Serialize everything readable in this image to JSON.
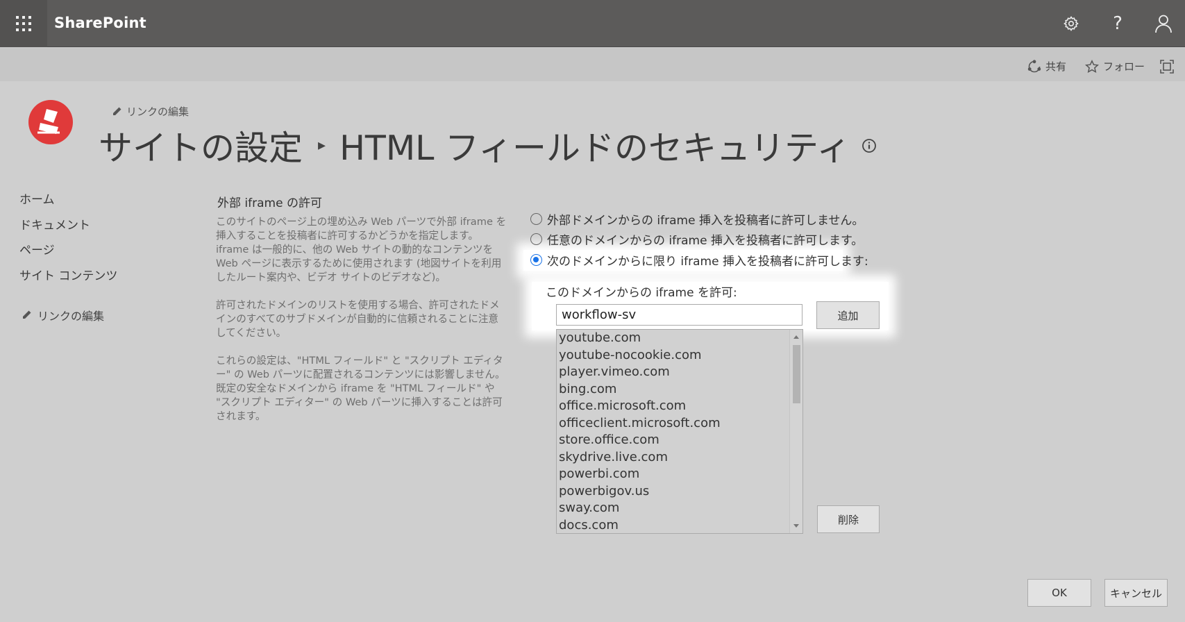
{
  "suitebar": {
    "brand": "SharePoint",
    "icons": [
      "app-launcher-icon",
      "settings-icon",
      "help-icon",
      "user-icon"
    ],
    "help_glyph": "?"
  },
  "commandbar": {
    "share": "共有",
    "follow": "フォロー"
  },
  "header": {
    "edit_links": "リンクの編集",
    "breadcrumb_parent": "サイトの設定",
    "breadcrumb_separator": "▸",
    "page_title": "HTML フィールドのセキュリティ"
  },
  "leftnav": {
    "items": [
      "ホーム",
      "ドキュメント",
      "ページ",
      "サイト コンテンツ"
    ],
    "edit_links": "リンクの編集"
  },
  "section": {
    "title": "外部 iframe の許可",
    "paragraphs": [
      "このサイトのページ上の埋め込み Web パーツで外部 iframe を挿入することを投稿者に許可するかどうかを指定します。iframe は一般的に、他の Web サイトの動的なコンテンツを Web ページに表示するために使用されます (地図サイトを利用したルート案内や、ビデオ サイトのビデオなど)。",
      "許可されたドメインのリストを使用する場合、許可されたドメインのすべてのサブドメインが自動的に信頼されることに注意してください。",
      "これらの設定は、\"HTML フィールド\" と \"スクリプト エディター\" の Web パーツに配置されるコンテンツには影響しません。既定の安全なドメインから iframe を \"HTML フィールド\" や \"スクリプト エディター\" の Web パーツに挿入することは許可されます。"
    ]
  },
  "options": [
    {
      "label": "外部ドメインからの iframe 挿入を投稿者に許可しません。",
      "checked": false
    },
    {
      "label": "任意のドメインからの iframe 挿入を投稿者に許可します。",
      "checked": false
    },
    {
      "label": "次のドメインからに限り iframe 挿入を投稿者に許可します:",
      "checked": true
    }
  ],
  "domains": {
    "allow_label": "このドメインからの iframe を許可:",
    "input_value": "workflow-sv",
    "add_button": "追加",
    "remove_button": "削除",
    "list": [
      "youtube.com",
      "youtube-nocookie.com",
      "player.vimeo.com",
      "bing.com",
      "office.microsoft.com",
      "officeclient.microsoft.com",
      "store.office.com",
      "skydrive.live.com",
      "powerbi.com",
      "powerbigov.us",
      "sway.com",
      "docs.com"
    ]
  },
  "footer": {
    "ok": "OK",
    "cancel": "キャンセル"
  },
  "colors": {
    "suitebar": "#5c5b5a",
    "background": "#cfcfcf",
    "logo_red": "#e03a3a",
    "radio_accent": "#1a73e8"
  }
}
